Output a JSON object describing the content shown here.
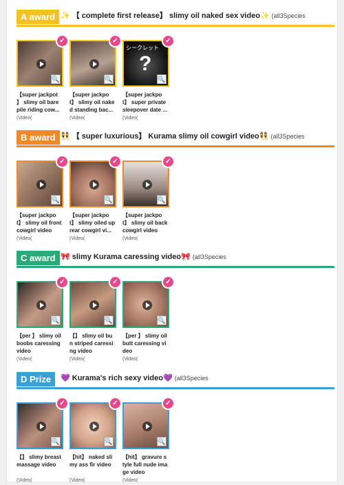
{
  "colors": {
    "A": "#f4c220",
    "B": "#f08a24",
    "C": "#2aa979",
    "D": "#3ba0d8",
    "check": "#e8488a"
  },
  "sections": [
    {
      "label": "A award",
      "title": "✨ 【 complete first release】 slimy oil naked sex video✨",
      "species": "(all3Species",
      "cards": [
        {
          "caption": "【super jackpot 】 slimy oil bare pile riding cow...",
          "meta": "(Video("
        },
        {
          "caption": "【super jackpo t】 slimy oil nake d standing bac...",
          "meta": "(Video("
        },
        {
          "caption": "【super jackpo t】 super private sleepover date ...",
          "meta": "(Video("
        }
      ]
    },
    {
      "label": "B award",
      "title": "👯 【 super luxurious】 Kurama slimy oil cowgirl video👯",
      "species": "(all3Species",
      "cards": [
        {
          "caption": "【super jackpo t】 slimy oil front cowgirl video",
          "meta": "(Video("
        },
        {
          "caption": "【super jackpo t】 slimy oiled up rear cowgirl vi...",
          "meta": "(Video("
        },
        {
          "caption": "【super jackpo t】 slimy oil back cowgirl video",
          "meta": "(Video("
        }
      ]
    },
    {
      "label": "C award",
      "title": "🎀 slimy Kurama caressing video🎀",
      "species": "(all3Species",
      "cards": [
        {
          "caption": "【per 】 slimy oil boobs caressing video",
          "meta": "(Video("
        },
        {
          "caption": "【】 slimy oil bu n striped caressi ng video",
          "meta": "(Video("
        },
        {
          "caption": "【per 】 slimy oil butt caressing vi deo",
          "meta": "(Video("
        }
      ]
    },
    {
      "label": "D Prize",
      "title": "💜 Kurama's rich sexy video💜",
      "species": "(all3Species",
      "cards": [
        {
          "caption": "【】 slimy breast massage video",
          "meta": "(Video("
        },
        {
          "caption": "【hit】 naked sli my ass fir video",
          "meta": "(Video("
        },
        {
          "caption": "【hit】 gravure s tyle full nude ima ge video",
          "meta": "(Video("
        }
      ]
    }
  ],
  "thumb_overlay_text": "シークレット",
  "icons": {
    "play": "play-icon",
    "zoom": "zoom-icon",
    "check": "check-icon"
  }
}
